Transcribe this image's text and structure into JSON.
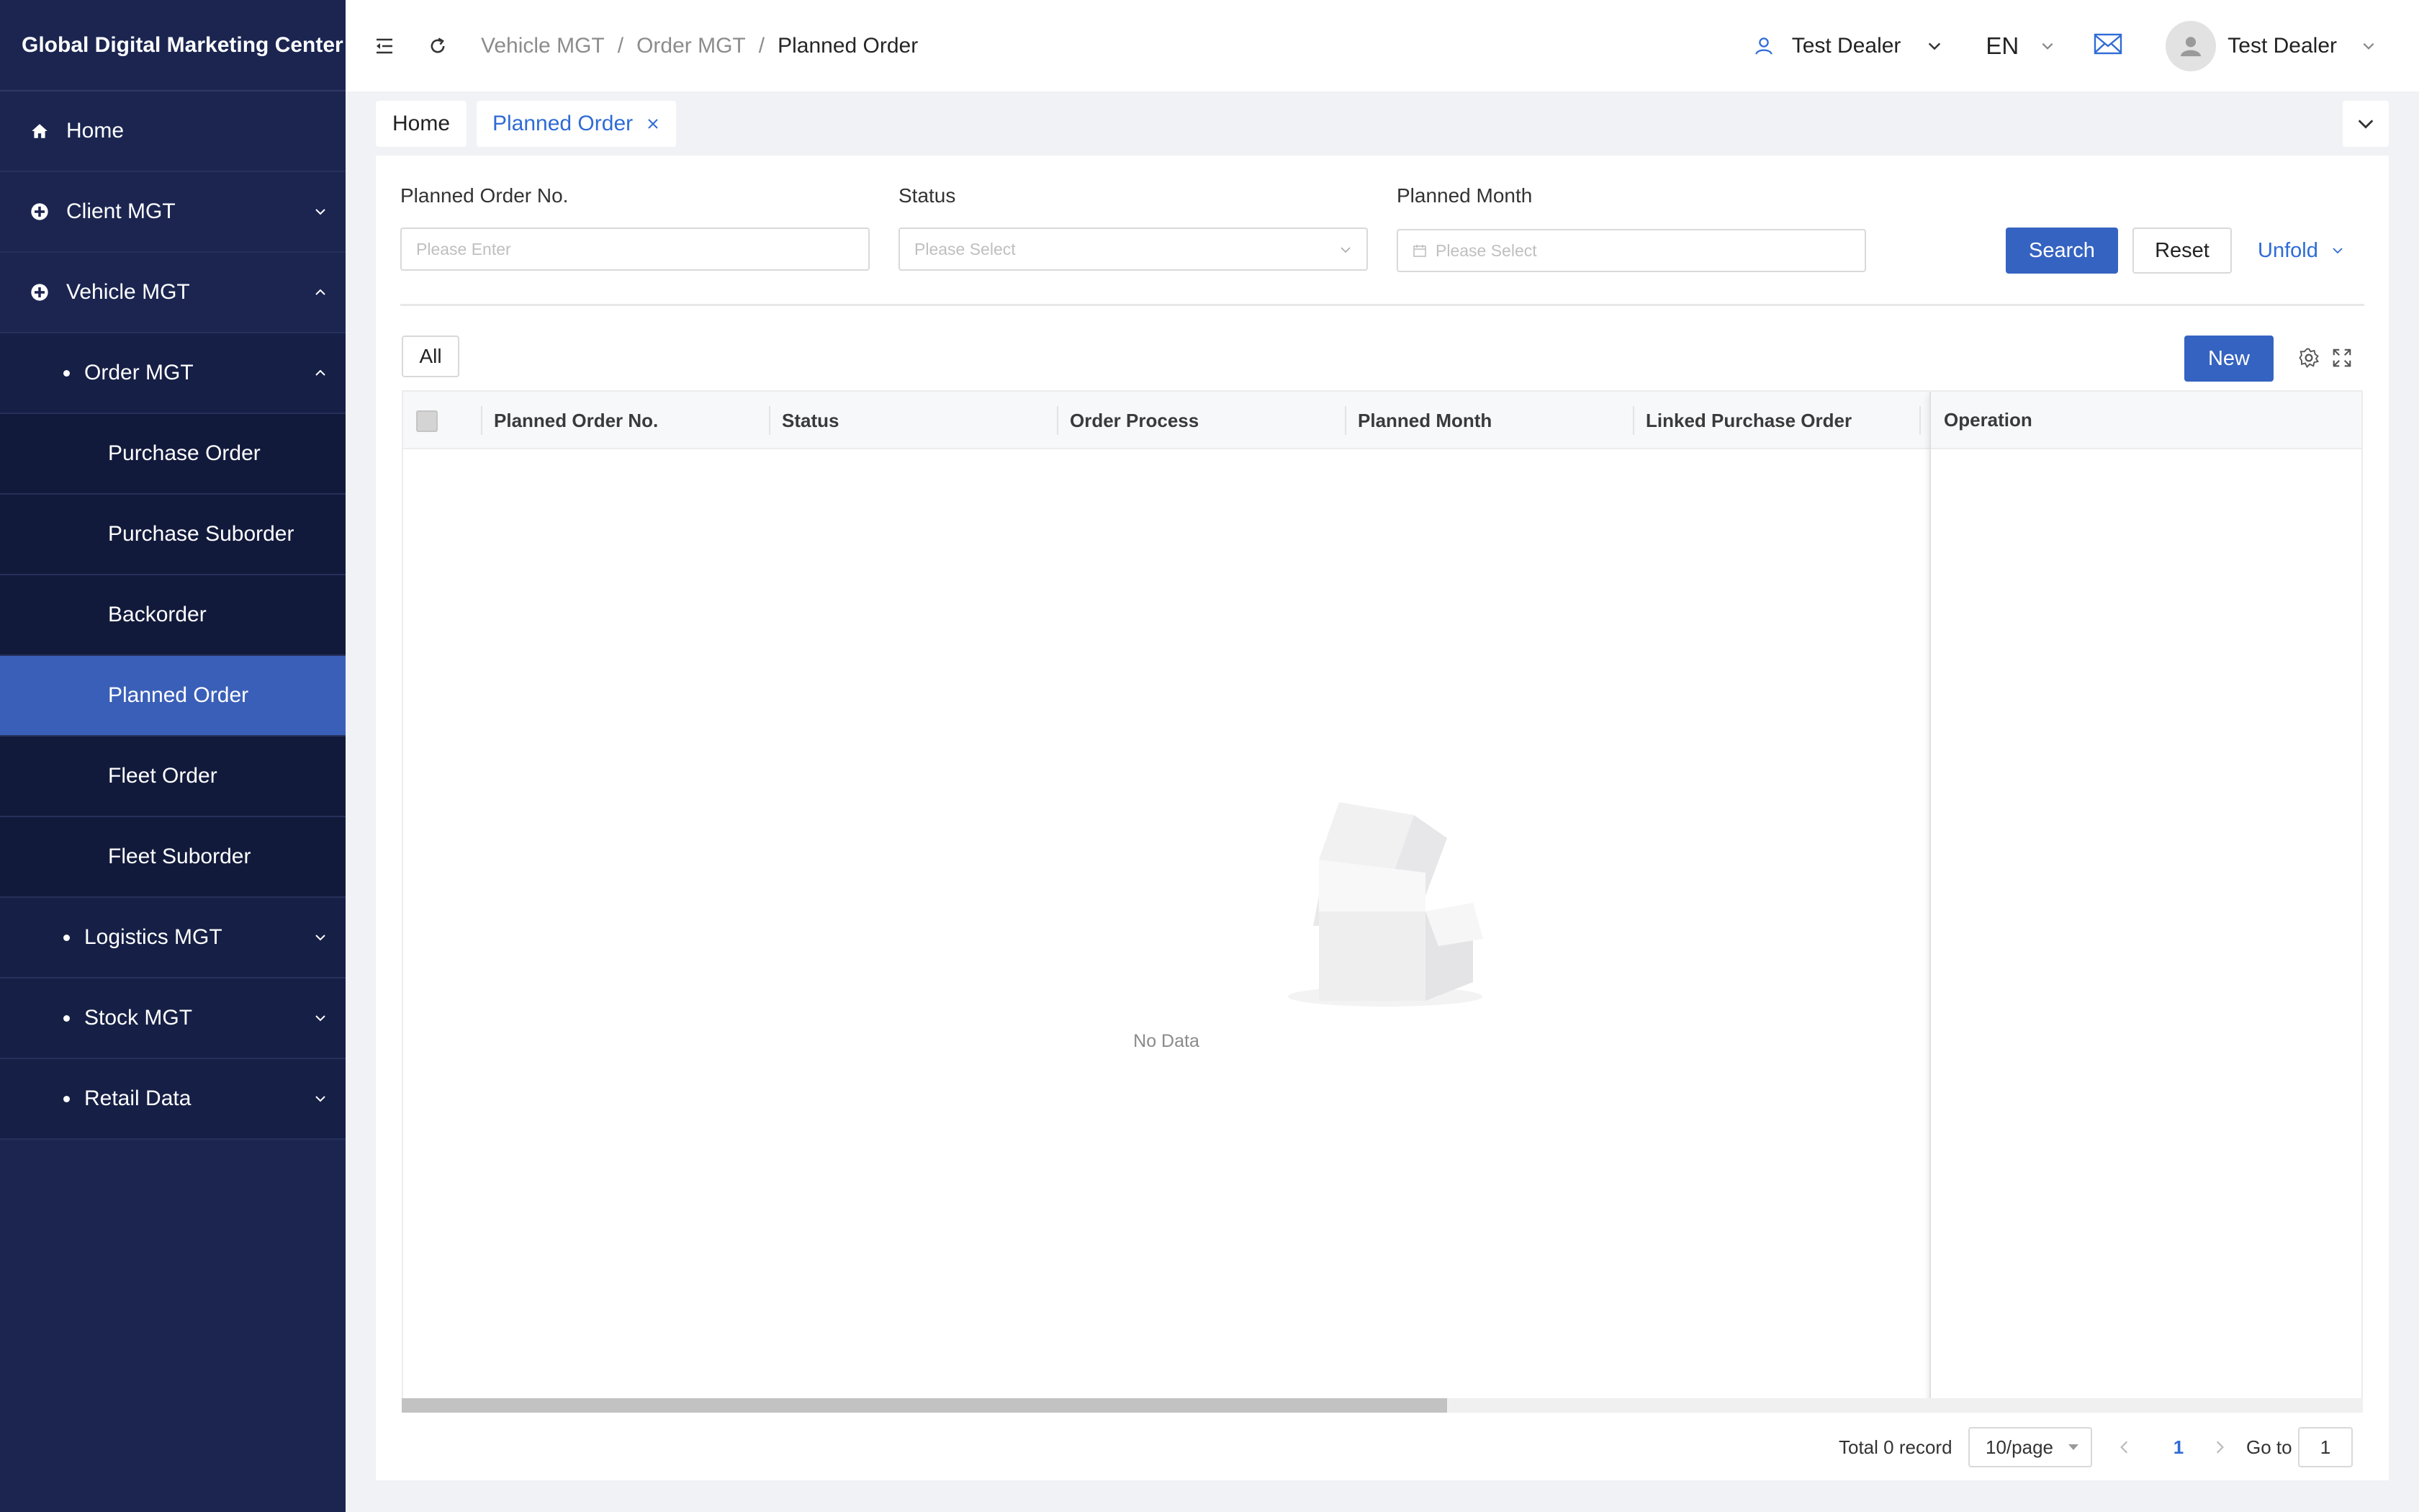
{
  "app": {
    "title": "Global Digital Marketing Center"
  },
  "sidebar": {
    "items": [
      {
        "label": "Home",
        "icon": "home-icon"
      },
      {
        "label": "Client MGT",
        "icon": "grid-icon"
      },
      {
        "label": "Vehicle MGT",
        "icon": "grid-icon"
      },
      {
        "label": "Order MGT"
      },
      {
        "label": "Purchase Order"
      },
      {
        "label": "Purchase Suborder"
      },
      {
        "label": "Backorder"
      },
      {
        "label": "Planned Order",
        "active": true
      },
      {
        "label": "Fleet Order"
      },
      {
        "label": "Fleet Suborder"
      },
      {
        "label": "Logistics MGT"
      },
      {
        "label": "Stock MGT"
      },
      {
        "label": "Retail Data"
      }
    ]
  },
  "header": {
    "breadcrumb": [
      "Vehicle MGT",
      "Order MGT",
      "Planned Order"
    ],
    "breadcrumb_sep": "/",
    "dealer": "Test Dealer",
    "language": "EN",
    "user": "Test Dealer"
  },
  "tabs": [
    {
      "label": "Home"
    },
    {
      "label": "Planned Order",
      "active": true
    }
  ],
  "filters": {
    "order_no": {
      "label": "Planned Order No.",
      "placeholder": "Please Enter"
    },
    "status": {
      "label": "Status",
      "placeholder": "Please Select"
    },
    "month": {
      "label": "Planned Month",
      "placeholder": "Please Select"
    },
    "search_label": "Search",
    "reset_label": "Reset",
    "unfold_label": "Unfold"
  },
  "toolbar": {
    "all_label": "All",
    "new_label": "New"
  },
  "table": {
    "columns": [
      "Planned Order No.",
      "Status",
      "Order Process",
      "Planned Month",
      "Linked Purchase Order",
      "Operation"
    ],
    "rows": [],
    "empty_text": "No Data"
  },
  "pagination": {
    "total": "Total 0 record",
    "page_size": "10/page",
    "current_page": "1",
    "goto_label": "Go to",
    "goto_value": "1"
  },
  "colors": {
    "sidebar_bg": "#1b2550",
    "sidebar_active": "#3a5fb8",
    "primary": "#3563c1",
    "link": "#2f6bd6"
  }
}
